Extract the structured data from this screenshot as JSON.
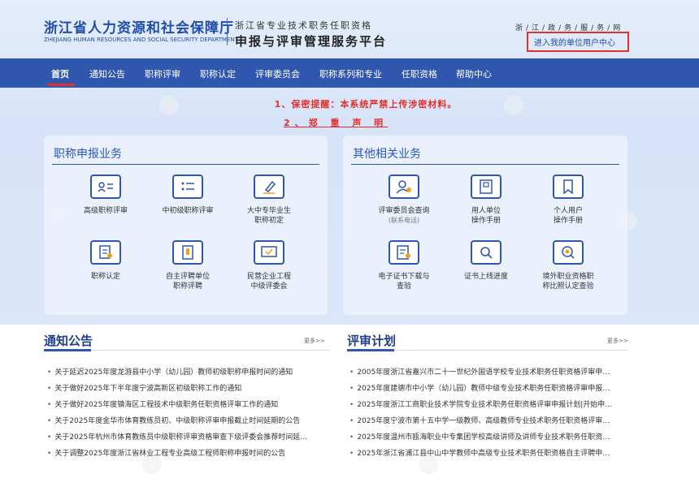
{
  "header": {
    "dept_cn": "浙江省人力资源和社会保障厅",
    "dept_en": "ZHEJIANG HUMAN RESOURCES AND SOCIAL SECURITY DEPARTMENT",
    "subtitle_top": "浙江省专业技术职务任职资格",
    "subtitle_main": "申报与评审管理服务平台",
    "gov_link": "浙/江/政/务/服/务/网",
    "unit_center_link": "进入我的单位用户中心"
  },
  "nav": {
    "items": [
      {
        "label": "首页"
      },
      {
        "label": "通知公告"
      },
      {
        "label": "职称评审"
      },
      {
        "label": "职称认定"
      },
      {
        "label": "评审委员会"
      },
      {
        "label": "职称系列和专业"
      },
      {
        "label": "任职资格"
      },
      {
        "label": "帮助中心"
      }
    ]
  },
  "notices": {
    "line1": "1、保密提醒：本系统严禁上传涉密材料。",
    "line2": "2、郑 重 声 明"
  },
  "panel_left": {
    "title": "职称申报业务",
    "tiles": [
      {
        "label": "高级职称评审",
        "icon": "id-card-icon"
      },
      {
        "label": "中初级职称评审",
        "icon": "list-icon"
      },
      {
        "label": "大中专毕业生",
        "label2": "职称初定",
        "icon": "pen-edit-icon"
      },
      {
        "label": "职称认定",
        "icon": "document-check-icon"
      },
      {
        "label": "自主评聘单位",
        "label2": "职称评聘",
        "icon": "certificate-icon"
      },
      {
        "label": "民营企业工程",
        "label2": "中级评委会",
        "icon": "monitor-check-icon"
      }
    ]
  },
  "panel_right": {
    "title": "其他相关业务",
    "tiles": [
      {
        "label": "评审委员会查询",
        "sub": "(联系电话)",
        "icon": "user-search-icon"
      },
      {
        "label": "用人单位",
        "label2": "操作手册",
        "icon": "manual-icon"
      },
      {
        "label": "个人用户",
        "label2": "操作手册",
        "icon": "bookmark-icon"
      },
      {
        "label": "电子证书下载与",
        "label2": "查验",
        "icon": "certificate-download-icon"
      },
      {
        "label": "证书上线进度",
        "icon": "search-icon"
      },
      {
        "label": "境外职业资格职",
        "label2": "称比照认定查验",
        "icon": "globe-search-icon"
      }
    ]
  },
  "announcements": {
    "title": "通知公告",
    "more": "更多>>",
    "items": [
      "关于延迟2025年度龙游县中小学（幼儿园）教师初级职称申报时间的通知",
      "关于做好2025年下半年度宁波高新区初级职称工作的通知",
      "关于做好2025年度镇海区工程技术中级职务任职资格评审工作的通知",
      "关于2025年度金华市体育教练员初、中级职称评审申报截止时间延期的公告",
      "关于2025年杭州市体育教练员中级职称评审资格审查下级评委会推荐时间延…",
      "关于调整2025年度浙江省林业工程专业高级工程师职称申报时间的公告"
    ]
  },
  "review_plan": {
    "title": "评审计划",
    "more": "更多>>",
    "items": [
      "2005年度浙江省嘉兴市二十一世纪外国语学校专业技术职务任职资格评审申…",
      "2025年度建德市中小学（幼儿园）教师中级专业技术职务任职资格评审申报…",
      "2025年度浙江工商职业技术学院专业技术职务任职资格评审申报计划|开始申…",
      "2025年度宁波市第十五中学一级教师、高级教师专业技术职务任职资格评审…",
      "2025年度温州市瓯海职业中专集团学校高级讲师及讲师专业技术职务任职资…",
      "2025年浙江省浦江县中山中学教师中高级专业技术职务任职资格自主评聘申…"
    ]
  },
  "colors": {
    "brand": "#2f57ad",
    "alert": "#e0312b",
    "title": "#1f4ea8"
  }
}
